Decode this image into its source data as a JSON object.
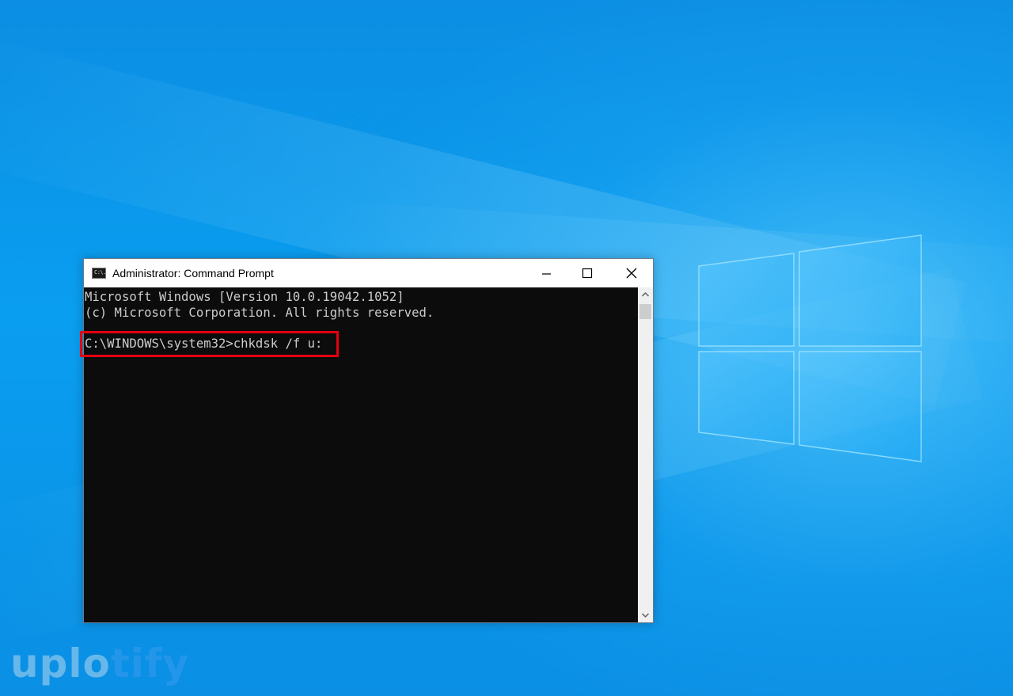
{
  "window": {
    "title": "Administrator: Command Prompt",
    "icon": "command-prompt-icon",
    "icon_glyph": "C:\\.",
    "controls": [
      "minimize-icon",
      "maximize-icon",
      "close-icon"
    ]
  },
  "console": {
    "lines": [
      "Microsoft Windows [Version 10.0.19042.1052]",
      "(c) Microsoft Corporation. All rights reserved.",
      "",
      "C:\\WINDOWS\\system32>chkdsk /f u:"
    ]
  },
  "watermark": {
    "part1": "uplo",
    "part2": "tify"
  },
  "colors": {
    "console_background": "#0c0c0c",
    "console_text": "#cccccc",
    "highlight": "#e3000f",
    "desktop": "#0a8fe6"
  }
}
